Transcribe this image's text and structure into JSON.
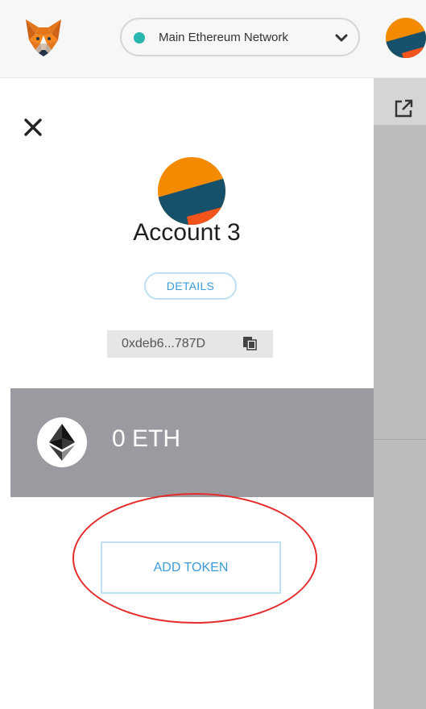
{
  "header": {
    "network": {
      "name": "Main Ethereum Network",
      "status_color": "#29b6af"
    },
    "logo_icon": "fox-icon",
    "avatar_icon": "identicon"
  },
  "sidebar": {
    "close_icon": "close-icon",
    "account": {
      "name": "Account 3",
      "details_label": "DETAILS",
      "address": "0xdeb6...787D",
      "copy_icon": "copy-icon"
    },
    "balance": {
      "amount": "0 ETH",
      "token_icon": "ethereum-icon"
    },
    "add_token_label": "ADD TOKEN"
  },
  "right_panel": {
    "link_icon": "external-link-icon"
  },
  "annotation": {
    "type": "red-ellipse",
    "color": "#e52c2c",
    "target": "add-token-button"
  },
  "colors": {
    "accent": "#3a9ad9",
    "balance_bg": "#9a9ba1",
    "header_bg": "#f7f7f7"
  }
}
